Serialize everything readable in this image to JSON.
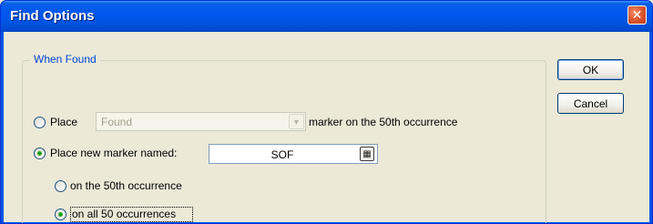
{
  "window": {
    "title": "Find Options",
    "close_icon": "close-icon"
  },
  "group": {
    "legend": "When Found"
  },
  "place_option": {
    "label": "Place",
    "combo_value": "Found",
    "suffix": "marker on the 50th occurrence",
    "selected": false
  },
  "place_new_option": {
    "label": "Place new marker named:",
    "marker_name": "SOF",
    "selected": true,
    "picker_icon": "calculator-icon"
  },
  "occurrence_options": [
    {
      "label": "on the 50th occurrence",
      "selected": false
    },
    {
      "label": "on all 50 occurrences",
      "selected": true
    }
  ],
  "buttons": {
    "ok": "OK",
    "cancel": "Cancel"
  },
  "colors": {
    "title_bar": "#0054e3",
    "dialog_bg": "#ece9d8",
    "legend_text": "#0046d5",
    "radio_dot": "#21a121",
    "close_button": "#e05a33"
  }
}
